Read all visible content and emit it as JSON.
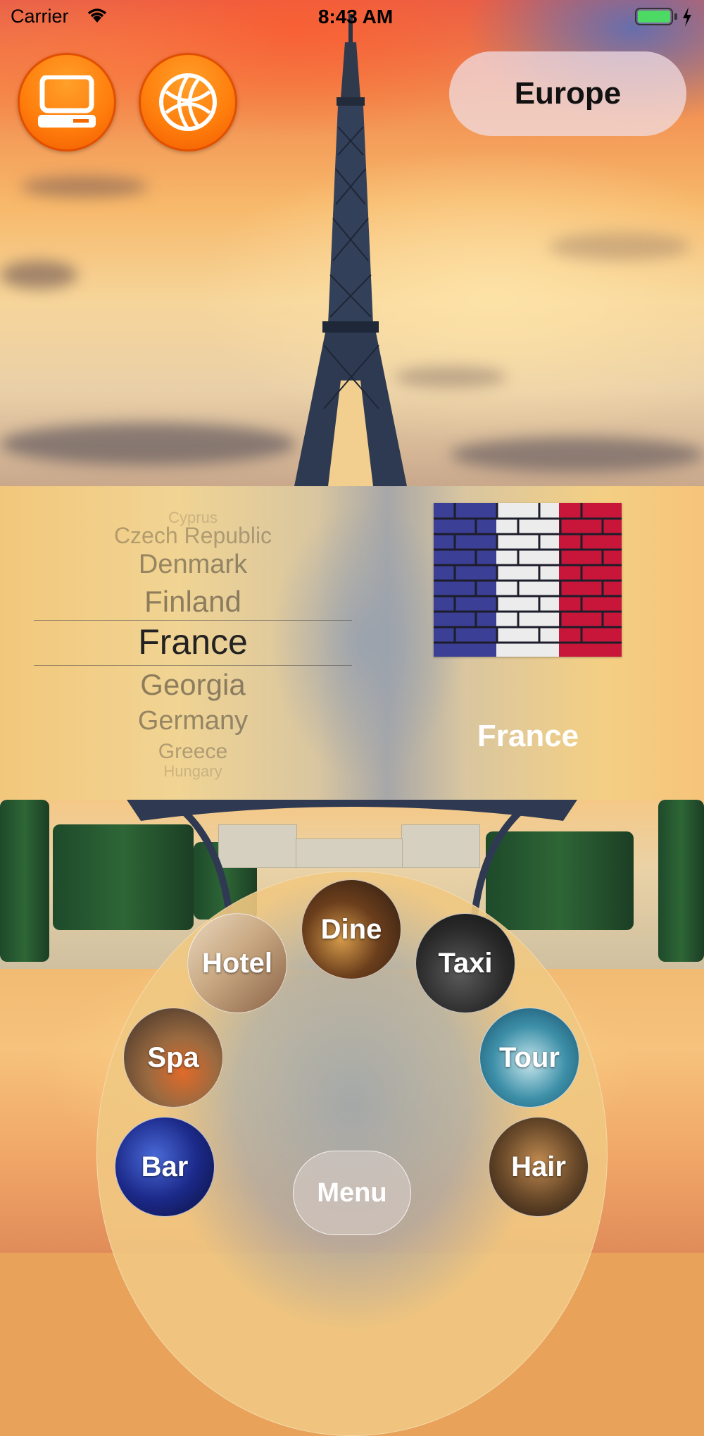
{
  "status_bar": {
    "carrier": "Carrier",
    "time": "8:43 AM"
  },
  "top_bar": {
    "region": "Europe",
    "left_icons": [
      "computer-icon",
      "globe-icon"
    ]
  },
  "picker": {
    "items": [
      "Cyprus",
      "Czech Republic",
      "Denmark",
      "Finland",
      "France",
      "Georgia",
      "Germany",
      "Greece",
      "Hungary"
    ],
    "selected": "France"
  },
  "selected_country": "France",
  "flag": {
    "colors": [
      "#3b3f96",
      "#ececec",
      "#c8163a"
    ]
  },
  "services": {
    "dine": "Dine",
    "hotel": "Hotel",
    "taxi": "Taxi",
    "spa": "Spa",
    "tour": "Tour",
    "bar": "Bar",
    "hair": "Hair"
  },
  "menu": {
    "label": "Menu"
  },
  "colors": {
    "accent_orange": "#ff7f0d",
    "battery_green": "#4cd964"
  }
}
